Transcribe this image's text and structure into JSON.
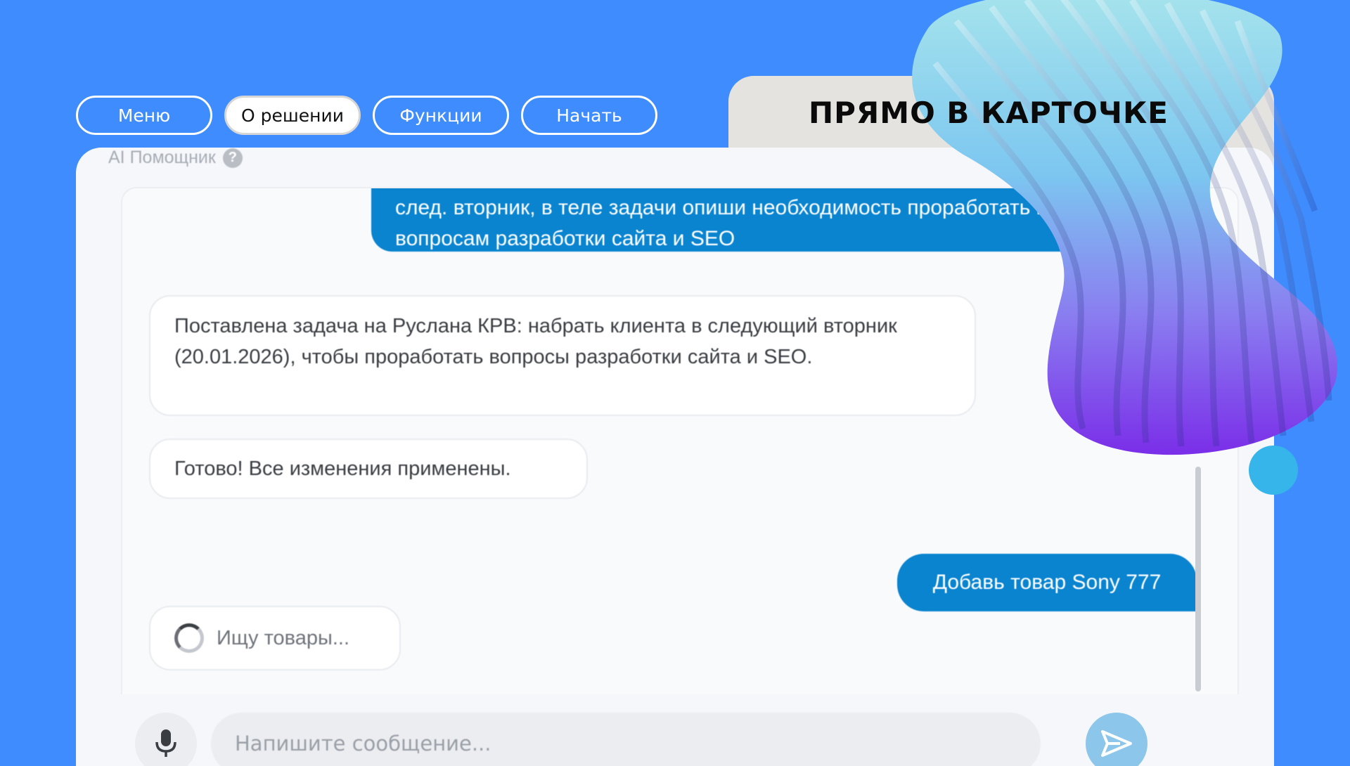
{
  "nav": {
    "items": [
      {
        "label": "Меню",
        "active": false
      },
      {
        "label": "О решении",
        "active": true
      },
      {
        "label": "Функции",
        "active": false
      },
      {
        "label": "Начать",
        "active": false
      }
    ]
  },
  "heading": "ПРЯМО В КАРТОЧКЕ",
  "panel": {
    "title": "AI Помощник",
    "help_icon": "?"
  },
  "chat": {
    "messages": [
      {
        "role": "user",
        "text": "след. вторник, в теле задачи опиши необходимость проработать клиента по вопросам разработки сайта и SEO"
      },
      {
        "role": "assistant",
        "text": "Поставлена задача на Руслана КРВ: набрать клиента в следующий вторник (20.01.2026), чтобы проработать вопросы разработки сайта и SEO."
      },
      {
        "role": "assistant",
        "text": "Готово! Все изменения применены."
      },
      {
        "role": "user",
        "text": "Добавь товар Sony 777"
      },
      {
        "role": "assistant",
        "text": "Ищу товары..."
      }
    ]
  },
  "input": {
    "placeholder": "Напишите сообщение...",
    "value": ""
  },
  "icons": {
    "mic": "microphone-icon",
    "send": "send-icon",
    "spinner": "spinner-icon",
    "help": "help-icon"
  },
  "colors": {
    "background": "#3f8cff",
    "user_bubble": "#0a84cf",
    "assistant_bubble": "#ffffff",
    "send_button": "#8cc6ea"
  }
}
